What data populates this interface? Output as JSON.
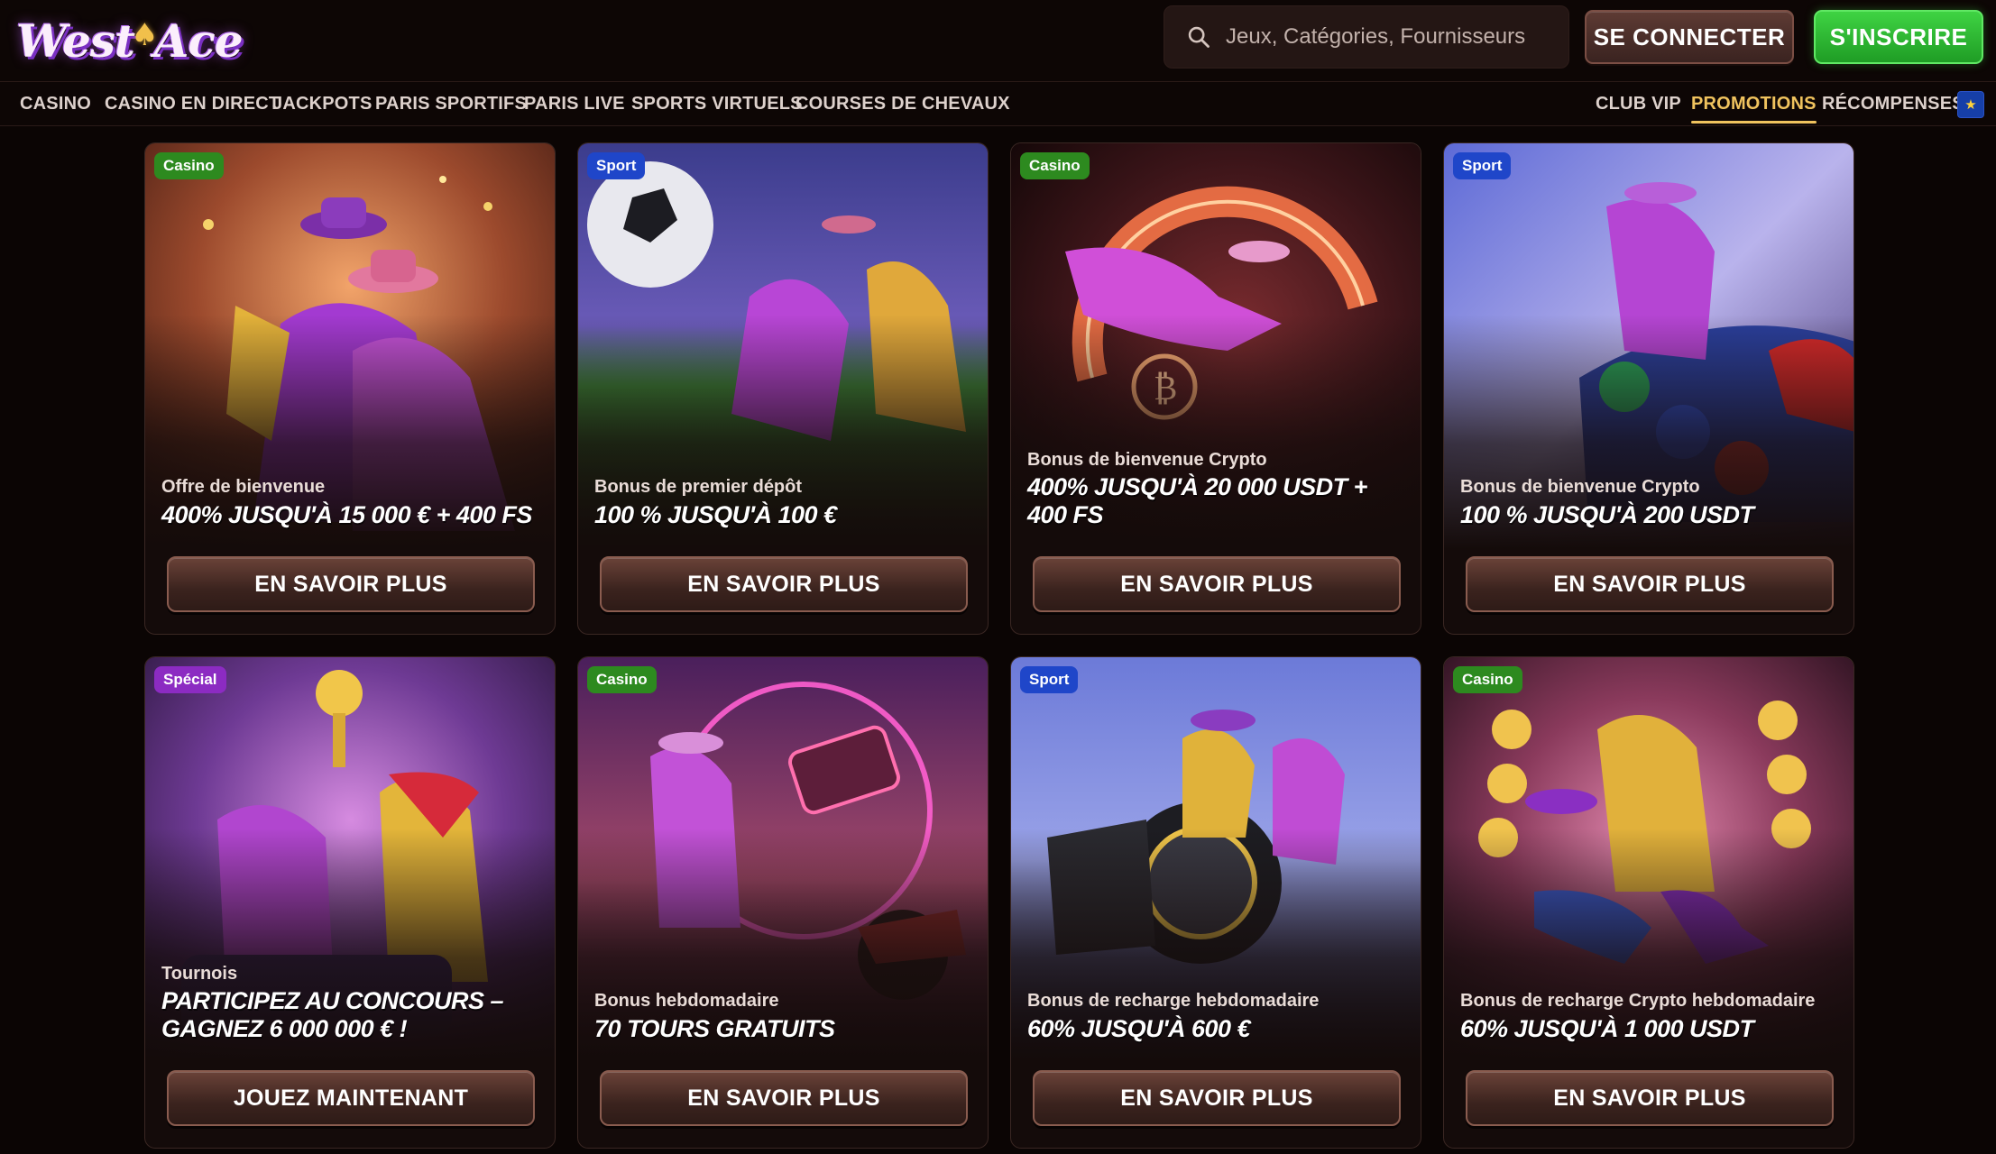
{
  "header": {
    "logo_text_1": "West",
    "logo_text_2": "Ace",
    "search_placeholder": "Jeux, Catégories, Fournisseurs",
    "login_label": "SE CONNECTER",
    "signup_label": "S'INSCRIRE"
  },
  "nav": {
    "left": [
      "CASINO",
      "CASINO EN DIRECT",
      "JACKPOTS",
      "PARIS SPORTIFS",
      "PARIS LIVE",
      "SPORTS VIRTUELS",
      "COURSES DE CHEVAUX"
    ],
    "right": [
      "CLUB VIP",
      "PROMOTIONS",
      "RÉCOMPENSES"
    ],
    "active": "PROMOTIONS"
  },
  "colors": {
    "accent_gold": "#f0c35e",
    "signup_green": "#2fb834",
    "tag_casino": "#2d8a1f",
    "tag_sport": "#1f46c9",
    "tag_special": "#8c2bc2"
  },
  "cards": [
    {
      "tag": "Casino",
      "subtitle": "Offre de bienvenue",
      "title": "400% JUSQU'À 15 000 € + 400 FS",
      "cta": "EN SAVOIR PLUS"
    },
    {
      "tag": "Sport",
      "subtitle": "Bonus de premier dépôt",
      "title": "100 % JUSQU'À 100 €",
      "cta": "EN SAVOIR PLUS"
    },
    {
      "tag": "Casino",
      "subtitle": "Bonus de bienvenue Crypto",
      "title": "400% JUSQU'À 20 000 USDT + 400 FS",
      "cta": "EN SAVOIR PLUS"
    },
    {
      "tag": "Sport",
      "subtitle": "Bonus de bienvenue Crypto",
      "title": "100 % JUSQU'À 200 USDT",
      "cta": "EN SAVOIR PLUS"
    },
    {
      "tag": "Spécial",
      "subtitle": "Tournois",
      "title": "PARTICIPEZ AU CONCOURS – GAGNEZ 6 000 000 € !",
      "cta": "JOUEZ MAINTENANT"
    },
    {
      "tag": "Casino",
      "subtitle": "Bonus hebdomadaire",
      "title": "70 TOURS GRATUITS",
      "cta": "EN SAVOIR PLUS"
    },
    {
      "tag": "Sport",
      "subtitle": "Bonus de recharge hebdomadaire",
      "title": "60% JUSQU'À 600 €",
      "cta": "EN SAVOIR PLUS"
    },
    {
      "tag": "Casino",
      "subtitle": "Bonus de recharge Crypto hebdomadaire",
      "title": "60% JUSQU'À 1 000 USDT",
      "cta": "EN SAVOIR PLUS"
    }
  ]
}
